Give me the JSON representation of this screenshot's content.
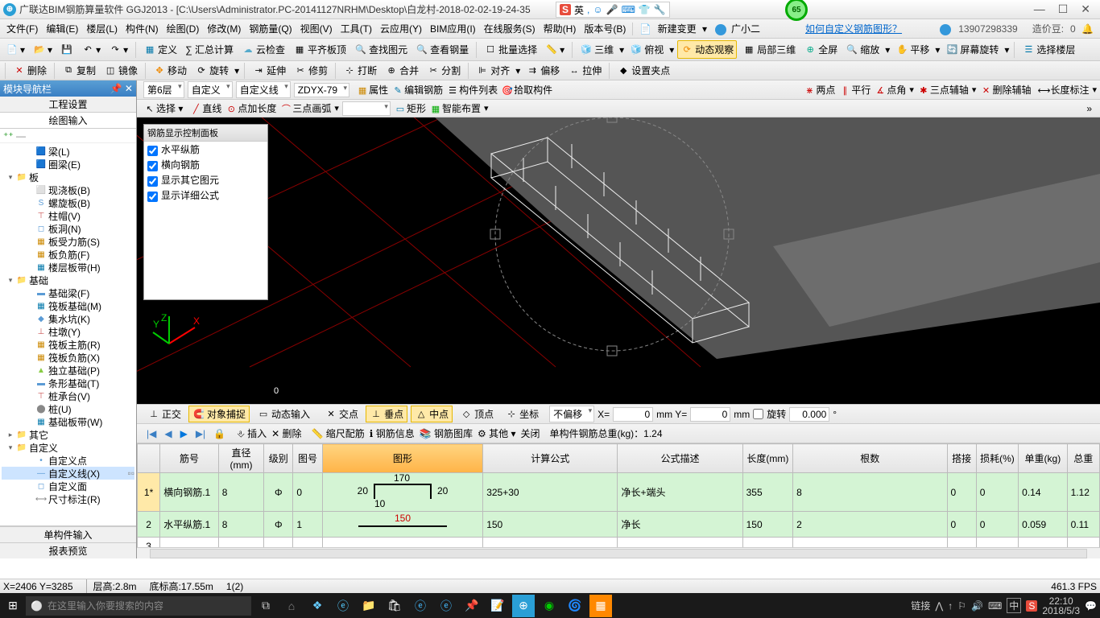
{
  "title": "广联达BIM钢筋算量软件 GGJ2013 - [C:\\Users\\Administrator.PC-20141127NRHM\\Desktop\\白龙村-2018-02-02-19-24-35",
  "ime": {
    "badge": "S",
    "lang": "英",
    "icons": [
      "☺",
      "🎤",
      "⌨",
      "👕",
      "🔧"
    ]
  },
  "green_badge": "65",
  "menu": [
    "文件(F)",
    "编辑(E)",
    "楼层(L)",
    "构件(N)",
    "绘图(D)",
    "修改(M)",
    "钢筋量(Q)",
    "视图(V)",
    "工具(T)",
    "云应用(Y)",
    "BIM应用(I)",
    "在线服务(S)",
    "帮助(H)",
    "版本号(B)"
  ],
  "menu_extras": {
    "new": "新建变更",
    "user": "广小二",
    "help_link": "如何自定义钢筋图形？"
  },
  "account": {
    "id": "13907298339",
    "credit_label": "造价豆:",
    "credit": "0"
  },
  "tb1": {
    "def": "定义",
    "sumcalc": "∑ 汇总计算",
    "cloudchk": "云检查",
    "flatroof": "平齐板顶",
    "findgfx": "查找图元",
    "viewbar": "查看钢量",
    "batchsel": "批量选择",
    "v3d": "三维",
    "front": "俯视",
    "dynview": "动态观察",
    "local3d": "局部三维",
    "full": "全屏",
    "zoom": "缩放",
    "pan": "平移",
    "scrrot": "屏幕旋转",
    "selfloor": "选择楼层"
  },
  "tb2": [
    "删除",
    "复制",
    "镜像",
    "移动",
    "旋转",
    "延伸",
    "修剪",
    "打断",
    "合并",
    "分割",
    "对齐",
    "偏移",
    "拉伸",
    "设置夹点"
  ],
  "ctx": {
    "floor": "第6层",
    "cat": "自定义",
    "type": "自定义线",
    "code": "ZDYX-79",
    "attr": "属性",
    "editbar": "编辑钢筋",
    "complist": "构件列表",
    "pick": "拾取构件",
    "twopt": "两点",
    "paral": "平行",
    "ptang": "点角",
    "threeaux": "三点辅轴",
    "delaux": "删除辅轴",
    "dimlbl": "长度标注"
  },
  "draw": {
    "sel": "选择",
    "line": "直线",
    "ptlen": "点加长度",
    "arc3": "三点画弧",
    "rect": "矩形",
    "smart": "智能布置"
  },
  "nav": {
    "title": "模块导航栏",
    "tabs": [
      "工程设置",
      "绘图输入"
    ],
    "bottom": [
      "单构件输入",
      "报表预览"
    ]
  },
  "tree": [
    {
      "d": 2,
      "i": "🟦",
      "t": "梁(L)",
      "ic": "#5b9bd5"
    },
    {
      "d": 2,
      "i": "🟦",
      "t": "圈梁(E)",
      "ic": "#5b9bd5"
    },
    {
      "d": 0,
      "tog": "▾",
      "i": "📁",
      "t": "板",
      "folder": 1
    },
    {
      "d": 2,
      "i": "⬜",
      "t": "现浇板(B)",
      "ic": "#8aa"
    },
    {
      "d": 2,
      "i": "S",
      "t": "螺旋板(B)",
      "ic": "#5b9bd5"
    },
    {
      "d": 2,
      "i": "⊤",
      "t": "柱帽(V)",
      "ic": "#c55"
    },
    {
      "d": 2,
      "i": "◻",
      "t": "板洞(N)",
      "ic": "#5b9bd5"
    },
    {
      "d": 2,
      "i": "▦",
      "t": "板受力筋(S)",
      "ic": "#c80"
    },
    {
      "d": 2,
      "i": "▦",
      "t": "板负筋(F)",
      "ic": "#c80"
    },
    {
      "d": 2,
      "i": "▦",
      "t": "楼层板带(H)",
      "ic": "#07a"
    },
    {
      "d": 0,
      "tog": "▾",
      "i": "📁",
      "t": "基础",
      "folder": 1
    },
    {
      "d": 2,
      "i": "▬",
      "t": "基础梁(F)",
      "ic": "#5b9bd5"
    },
    {
      "d": 2,
      "i": "▦",
      "t": "筏板基础(M)",
      "ic": "#07a"
    },
    {
      "d": 2,
      "i": "◆",
      "t": "集水坑(K)",
      "ic": "#5b9bd5"
    },
    {
      "d": 2,
      "i": "⊥",
      "t": "柱墩(Y)",
      "ic": "#c55"
    },
    {
      "d": 2,
      "i": "▦",
      "t": "筏板主筋(R)",
      "ic": "#c80"
    },
    {
      "d": 2,
      "i": "▦",
      "t": "筏板负筋(X)",
      "ic": "#c80"
    },
    {
      "d": 2,
      "i": "▲",
      "t": "独立基础(P)",
      "ic": "#8c4"
    },
    {
      "d": 2,
      "i": "▬",
      "t": "条形基础(T)",
      "ic": "#5b9bd5"
    },
    {
      "d": 2,
      "i": "⊤",
      "t": "桩承台(V)",
      "ic": "#c55"
    },
    {
      "d": 2,
      "i": "⬤",
      "t": "桩(U)",
      "ic": "#888"
    },
    {
      "d": 2,
      "i": "▦",
      "t": "基础板带(W)",
      "ic": "#07a"
    },
    {
      "d": 0,
      "tog": "▸",
      "i": "📁",
      "t": "其它",
      "folder": 1
    },
    {
      "d": 0,
      "tog": "▾",
      "i": "📁",
      "t": "自定义",
      "folder": 1
    },
    {
      "d": 2,
      "i": "•",
      "t": "自定义点",
      "ic": "#5b9bd5"
    },
    {
      "d": 2,
      "i": "—",
      "t": "自定义线(X)",
      "ic": "#5b9bd5",
      "sel": 1,
      "extra": "▫▫"
    },
    {
      "d": 2,
      "i": "◻",
      "t": "自定义面",
      "ic": "#5b9bd5"
    },
    {
      "d": 2,
      "i": "⟷",
      "t": "尺寸标注(R)",
      "ic": "#888"
    }
  ],
  "rebar_panel": {
    "title": "钢筋显示控制面板",
    "items": [
      "水平纵筋",
      "横向钢筋",
      "显示其它图元",
      "显示详细公式"
    ]
  },
  "origin": "0",
  "snap": {
    "ortho": "正交",
    "osnap": "对象捕捉",
    "dyninp": "动态输入",
    "inter": "交点",
    "perp": "垂点",
    "mid": "中点",
    "vert": "顶点",
    "coord": "坐标",
    "noofs": "不偏移",
    "xlbl": "X=",
    "xval": "0",
    "yunitlabel": "mm Y=",
    "yval": "0",
    "unit2": "mm",
    "rot": "旋转",
    "rotval": "0.000",
    "rotunit": "°"
  },
  "rtools": {
    "ins": "插入",
    "del": "删除",
    "match": "缩尺配筋",
    "info": "钢筋信息",
    "lib": "钢筋图库",
    "other": "其他",
    "close": "关闭",
    "totlbl": "单构件钢筋总重(kg)：",
    "tot": "1.24"
  },
  "cols": [
    "",
    "筋号",
    "直径(mm)",
    "级别",
    "图号",
    "图形",
    "计算公式",
    "公式描述",
    "长度(mm)",
    "根数",
    "搭接",
    "损耗(%)",
    "单重(kg)",
    "总重"
  ],
  "rows": [
    {
      "n": "1*",
      "name": "横向钢筋.1",
      "dia": "8",
      "lvl": "Φ",
      "gno": "0",
      "shape": {
        "w": "170",
        "h": "20",
        "b": "10",
        "ho": "20"
      },
      "calc": "325+30",
      "desc": "净长+端头",
      "len": "355",
      "cnt": "8",
      "lap": "0",
      "loss": "0",
      "uw": "0.14",
      "tw": "1.12"
    },
    {
      "n": "2",
      "name": "水平纵筋.1",
      "dia": "8",
      "lvl": "Φ",
      "gno": "1",
      "shape": {
        "line": "150"
      },
      "calc": "150",
      "desc": "净长",
      "len": "150",
      "cnt": "2",
      "lap": "0",
      "loss": "0",
      "uw": "0.059",
      "tw": "0.11"
    },
    {
      "n": "3"
    }
  ],
  "status": {
    "xy": "X=2406 Y=3285",
    "fh": "层高:2.8m",
    "bb": "底标高:17.55m",
    "sel": "1(2)",
    "fps": "461.3 FPS"
  },
  "taskbar": {
    "search": "在这里输入你要搜索的内容",
    "tray": [
      "链接",
      "⋀",
      "↑",
      "⚐",
      "🔊",
      "⌨",
      "中",
      "S"
    ],
    "time": "22:10",
    "date": "2018/5/3"
  }
}
